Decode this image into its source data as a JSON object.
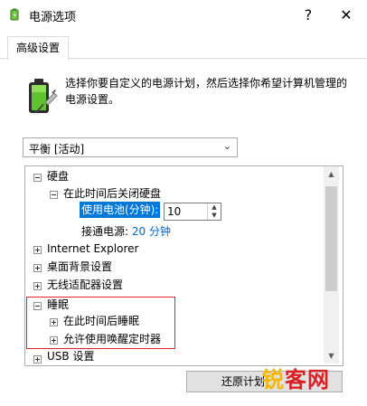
{
  "window": {
    "title": "电源选项",
    "help_label": "?",
    "close_label": "✕"
  },
  "tabs": [
    {
      "label": "高级设置",
      "active": true
    }
  ],
  "description": "选择你要自定义的电源计划，然后选择你希望计算机管理的电源设置。",
  "plan_select": {
    "value": "平衡 [活动]"
  },
  "tree": {
    "items": [
      {
        "label": "硬盘",
        "expander": "−"
      },
      {
        "label": "在此时间后关闭硬盘",
        "expander": "−"
      },
      {
        "label": "使用电池(分钟):"
      },
      {
        "label": "接通电源:",
        "value": "20 分钟"
      },
      {
        "label": "Internet Explorer",
        "expander": "+"
      },
      {
        "label": "桌面背景设置",
        "expander": "+"
      },
      {
        "label": "无线适配器设置",
        "expander": "+"
      },
      {
        "label": "睡眠",
        "expander": "−"
      },
      {
        "label": "在此时间后睡眠",
        "expander": "+"
      },
      {
        "label": "允许使用唤醒定时器",
        "expander": "+"
      },
      {
        "label": "USB 设置",
        "expander": "+"
      }
    ],
    "battery_minutes": "10"
  },
  "restore_button": {
    "label": "还原计划"
  },
  "watermark": {
    "part1": "锐",
    "part2": "客网"
  },
  "colors": {
    "accent": "#0078d7",
    "link": "#0066cc",
    "highlight_box": "#e2232a",
    "watermark_orange": "#f7b500",
    "watermark_red": "#d92024"
  },
  "icons": {
    "app": "power-options-icon",
    "battery": "battery-plug-icon"
  }
}
